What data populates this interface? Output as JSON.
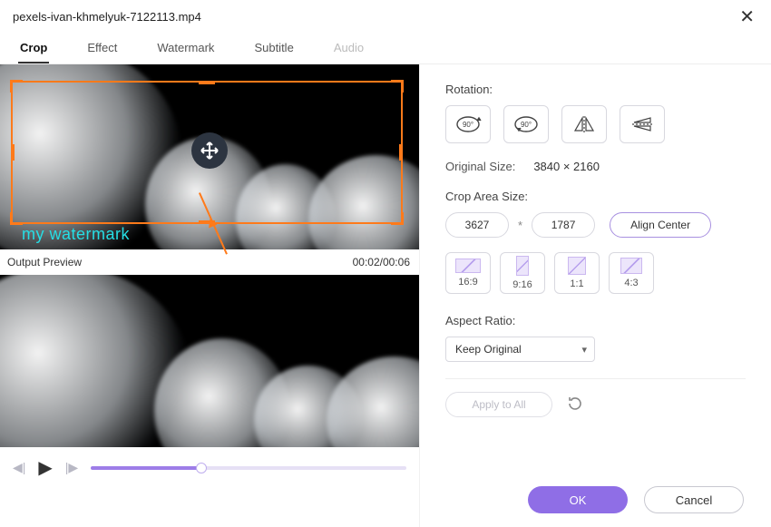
{
  "title": "pexels-ivan-khmelyuk-7122113.mp4",
  "tabs": {
    "crop": "Crop",
    "effect": "Effect",
    "watermark": "Watermark",
    "subtitle": "Subtitle",
    "audio": "Audio"
  },
  "preview": {
    "output_label": "Output Preview",
    "timecode": "00:02/00:06",
    "watermark_text": "my watermark"
  },
  "rotation": {
    "label": "Rotation:"
  },
  "original_size": {
    "label": "Original Size:",
    "value": "3840 × 2160"
  },
  "crop_area": {
    "label": "Crop Area Size:",
    "width": "3627",
    "star": "*",
    "height": "1787",
    "align_center": "Align Center"
  },
  "ratios": {
    "r169": "16:9",
    "r916": "9:16",
    "r11": "1:1",
    "r43": "4:3"
  },
  "aspect": {
    "label": "Aspect Ratio:",
    "value": "Keep Original"
  },
  "apply_all": "Apply to All",
  "footer": {
    "ok": "OK",
    "cancel": "Cancel"
  }
}
